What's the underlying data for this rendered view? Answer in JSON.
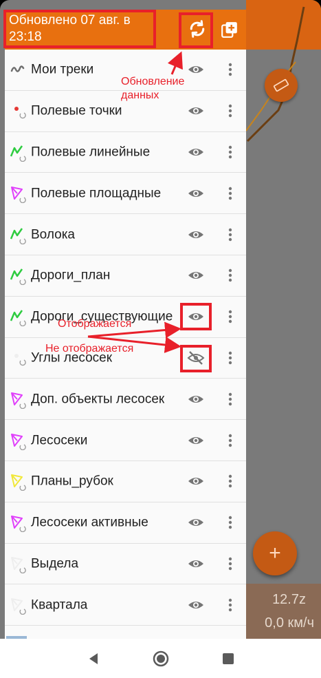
{
  "header": {
    "title": "Обновлено 07 авг. в 23:18",
    "refresh_icon": "refresh-icon",
    "add_layer_icon": "add-layer-icon",
    "color": "#e8700f"
  },
  "layers": [
    {
      "label": "Мои треки",
      "icon": "track-icon",
      "visible": true
    },
    {
      "label": "Полевые точки",
      "icon": "point-layer-icon",
      "visible": true
    },
    {
      "label": "Полевые линейные",
      "icon": "line-layer-icon",
      "visible": true
    },
    {
      "label": "Полевые площадные",
      "icon": "polygon-layer-icon",
      "visible": true
    },
    {
      "label": "Волока",
      "icon": "line-layer-icon",
      "visible": true
    },
    {
      "label": "Дороги_план",
      "icon": "line-layer-icon",
      "visible": true
    },
    {
      "label": "Дороги_существующие",
      "icon": "line-layer-icon",
      "visible": true
    },
    {
      "label": "Углы лесосек",
      "icon": "point-layer-icon",
      "visible": false
    },
    {
      "label": "Доп. объекты лесосек",
      "icon": "polygon-layer-icon",
      "visible": true
    },
    {
      "label": "Лесосеки",
      "icon": "polygon-layer-icon",
      "visible": true
    },
    {
      "label": "Планы_рубок",
      "icon": "polygon-layer-icon",
      "visible": true
    },
    {
      "label": "Лесосеки активные",
      "icon": "polygon-layer-icon",
      "visible": true
    },
    {
      "label": "Выдела",
      "icon": "polygon-layer-icon",
      "visible": true
    },
    {
      "label": "Квартала",
      "icon": "polygon-layer-icon",
      "visible": true
    }
  ],
  "map": {
    "zoom": "12.7z",
    "speed": "0,0 км/ч",
    "fab_label": "+"
  },
  "annotations": {
    "refresh": "Обновление данных",
    "visible": "Отображается",
    "hidden": "Не отображается",
    "color": "#e8202a"
  },
  "nav": {
    "back_icon": "back-icon",
    "home_icon": "home-icon",
    "recent_icon": "recent-apps-icon"
  }
}
